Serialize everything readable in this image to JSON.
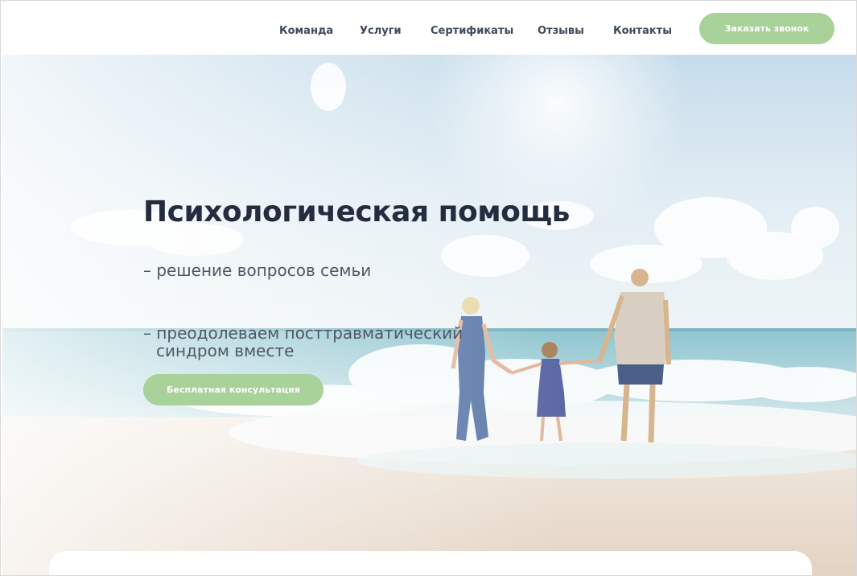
{
  "nav": {
    "items": [
      {
        "label": "Команда"
      },
      {
        "label": "Услуги"
      },
      {
        "label": "Сертификаты"
      },
      {
        "label": "Отзывы"
      },
      {
        "label": "Контакты"
      }
    ],
    "cta_label": "Заказать звонок"
  },
  "hero": {
    "title": "Психологическая помощь",
    "line1": "– решение вопросов семьи",
    "line2_a": "– преодолеваем посттравматический",
    "line2_b": "синдром вместе",
    "cta_label": "Бесплатная консультация",
    "image_icon": "beach-family-photo"
  },
  "colors": {
    "accent_green": "#a9d29b",
    "title_dark": "#232d3f",
    "nav_text": "#3f4a5a",
    "sky_top": "#cfe3ef",
    "sea": "#7fb9c8",
    "sand": "#e8dccd"
  }
}
